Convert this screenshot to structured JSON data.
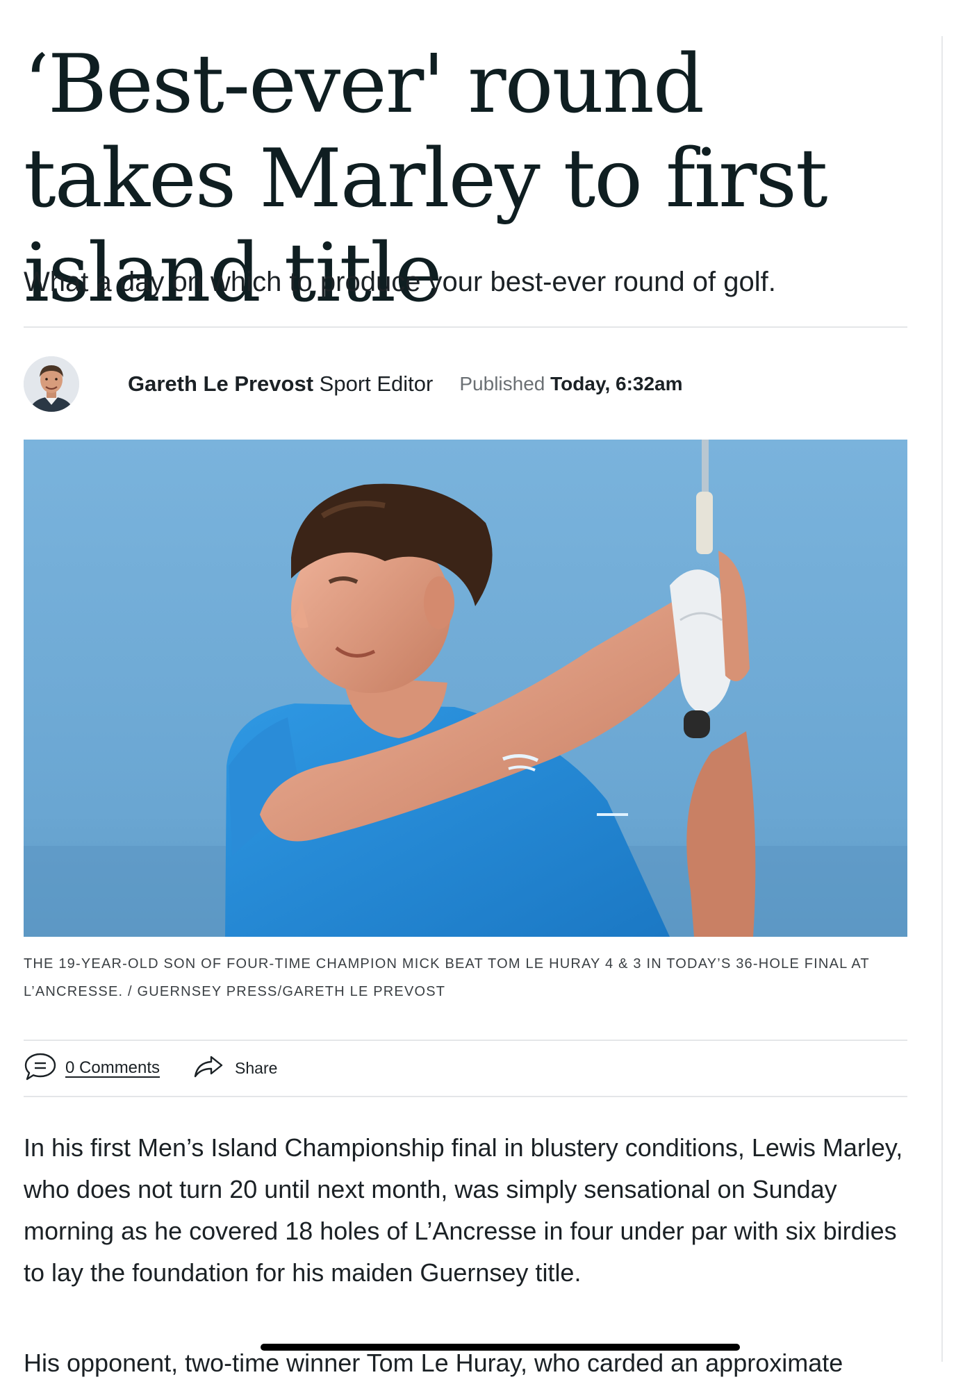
{
  "article": {
    "headline": "‘Best-ever' round takes Marley to first island title",
    "standfirst": "What a day on which to produce your best-ever round of golf.",
    "author": {
      "name": "Gareth Le Prevost",
      "role": "Sport Editor"
    },
    "published": {
      "label": "Published",
      "time": "Today, 6:32am"
    },
    "image_caption": "THE 19-YEAR-OLD SON OF FOUR-TIME CHAMPION MICK BEAT TOM LE HURAY 4 & 3 IN TODAY’S 36-HOLE FINAL AT L’ANCRESSE. / GUERNSEY PRESS/GARETH LE PREVOST",
    "actions": {
      "comments_label": "0 Comments",
      "share_label": "Share"
    },
    "paragraphs": [
      "In his first Men’s Island Championship final in blustery conditions, Lewis Marley, who does not turn 20 until next month, was simply sensational on Sunday morning as he covered 18 holes of L’Ancresse in four under par with six birdies to lay the foundation for his maiden Guernsey title.",
      "His opponent, two-time winner Tom Le Huray, who carded an approximate"
    ]
  },
  "icons": {
    "comments": "speech-bubble-icon",
    "share": "share-arrow-icon"
  },
  "colors": {
    "headline": "#0f1e21",
    "text": "#1b2125",
    "muted": "#6b7074",
    "rule": "#e4e6e8",
    "photo_sky": "#74afd9"
  }
}
